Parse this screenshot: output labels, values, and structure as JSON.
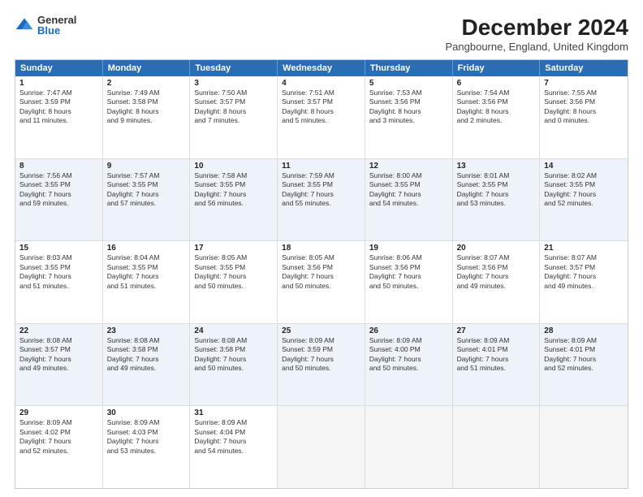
{
  "logo": {
    "general": "General",
    "blue": "Blue"
  },
  "title": "December 2024",
  "location": "Pangbourne, England, United Kingdom",
  "header_days": [
    "Sunday",
    "Monday",
    "Tuesday",
    "Wednesday",
    "Thursday",
    "Friday",
    "Saturday"
  ],
  "rows": [
    [
      {
        "day": "1",
        "lines": [
          "Sunrise: 7:47 AM",
          "Sunset: 3:59 PM",
          "Daylight: 8 hours",
          "and 11 minutes."
        ]
      },
      {
        "day": "2",
        "lines": [
          "Sunrise: 7:49 AM",
          "Sunset: 3:58 PM",
          "Daylight: 8 hours",
          "and 9 minutes."
        ]
      },
      {
        "day": "3",
        "lines": [
          "Sunrise: 7:50 AM",
          "Sunset: 3:57 PM",
          "Daylight: 8 hours",
          "and 7 minutes."
        ]
      },
      {
        "day": "4",
        "lines": [
          "Sunrise: 7:51 AM",
          "Sunset: 3:57 PM",
          "Daylight: 8 hours",
          "and 5 minutes."
        ]
      },
      {
        "day": "5",
        "lines": [
          "Sunrise: 7:53 AM",
          "Sunset: 3:56 PM",
          "Daylight: 8 hours",
          "and 3 minutes."
        ]
      },
      {
        "day": "6",
        "lines": [
          "Sunrise: 7:54 AM",
          "Sunset: 3:56 PM",
          "Daylight: 8 hours",
          "and 2 minutes."
        ]
      },
      {
        "day": "7",
        "lines": [
          "Sunrise: 7:55 AM",
          "Sunset: 3:56 PM",
          "Daylight: 8 hours",
          "and 0 minutes."
        ]
      }
    ],
    [
      {
        "day": "8",
        "lines": [
          "Sunrise: 7:56 AM",
          "Sunset: 3:55 PM",
          "Daylight: 7 hours",
          "and 59 minutes."
        ]
      },
      {
        "day": "9",
        "lines": [
          "Sunrise: 7:57 AM",
          "Sunset: 3:55 PM",
          "Daylight: 7 hours",
          "and 57 minutes."
        ]
      },
      {
        "day": "10",
        "lines": [
          "Sunrise: 7:58 AM",
          "Sunset: 3:55 PM",
          "Daylight: 7 hours",
          "and 56 minutes."
        ]
      },
      {
        "day": "11",
        "lines": [
          "Sunrise: 7:59 AM",
          "Sunset: 3:55 PM",
          "Daylight: 7 hours",
          "and 55 minutes."
        ]
      },
      {
        "day": "12",
        "lines": [
          "Sunrise: 8:00 AM",
          "Sunset: 3:55 PM",
          "Daylight: 7 hours",
          "and 54 minutes."
        ]
      },
      {
        "day": "13",
        "lines": [
          "Sunrise: 8:01 AM",
          "Sunset: 3:55 PM",
          "Daylight: 7 hours",
          "and 53 minutes."
        ]
      },
      {
        "day": "14",
        "lines": [
          "Sunrise: 8:02 AM",
          "Sunset: 3:55 PM",
          "Daylight: 7 hours",
          "and 52 minutes."
        ]
      }
    ],
    [
      {
        "day": "15",
        "lines": [
          "Sunrise: 8:03 AM",
          "Sunset: 3:55 PM",
          "Daylight: 7 hours",
          "and 51 minutes."
        ]
      },
      {
        "day": "16",
        "lines": [
          "Sunrise: 8:04 AM",
          "Sunset: 3:55 PM",
          "Daylight: 7 hours",
          "and 51 minutes."
        ]
      },
      {
        "day": "17",
        "lines": [
          "Sunrise: 8:05 AM",
          "Sunset: 3:55 PM",
          "Daylight: 7 hours",
          "and 50 minutes."
        ]
      },
      {
        "day": "18",
        "lines": [
          "Sunrise: 8:05 AM",
          "Sunset: 3:56 PM",
          "Daylight: 7 hours",
          "and 50 minutes."
        ]
      },
      {
        "day": "19",
        "lines": [
          "Sunrise: 8:06 AM",
          "Sunset: 3:56 PM",
          "Daylight: 7 hours",
          "and 50 minutes."
        ]
      },
      {
        "day": "20",
        "lines": [
          "Sunrise: 8:07 AM",
          "Sunset: 3:56 PM",
          "Daylight: 7 hours",
          "and 49 minutes."
        ]
      },
      {
        "day": "21",
        "lines": [
          "Sunrise: 8:07 AM",
          "Sunset: 3:57 PM",
          "Daylight: 7 hours",
          "and 49 minutes."
        ]
      }
    ],
    [
      {
        "day": "22",
        "lines": [
          "Sunrise: 8:08 AM",
          "Sunset: 3:57 PM",
          "Daylight: 7 hours",
          "and 49 minutes."
        ]
      },
      {
        "day": "23",
        "lines": [
          "Sunrise: 8:08 AM",
          "Sunset: 3:58 PM",
          "Daylight: 7 hours",
          "and 49 minutes."
        ]
      },
      {
        "day": "24",
        "lines": [
          "Sunrise: 8:08 AM",
          "Sunset: 3:58 PM",
          "Daylight: 7 hours",
          "and 50 minutes."
        ]
      },
      {
        "day": "25",
        "lines": [
          "Sunrise: 8:09 AM",
          "Sunset: 3:59 PM",
          "Daylight: 7 hours",
          "and 50 minutes."
        ]
      },
      {
        "day": "26",
        "lines": [
          "Sunrise: 8:09 AM",
          "Sunset: 4:00 PM",
          "Daylight: 7 hours",
          "and 50 minutes."
        ]
      },
      {
        "day": "27",
        "lines": [
          "Sunrise: 8:09 AM",
          "Sunset: 4:01 PM",
          "Daylight: 7 hours",
          "and 51 minutes."
        ]
      },
      {
        "day": "28",
        "lines": [
          "Sunrise: 8:09 AM",
          "Sunset: 4:01 PM",
          "Daylight: 7 hours",
          "and 52 minutes."
        ]
      }
    ],
    [
      {
        "day": "29",
        "lines": [
          "Sunrise: 8:09 AM",
          "Sunset: 4:02 PM",
          "Daylight: 7 hours",
          "and 52 minutes."
        ]
      },
      {
        "day": "30",
        "lines": [
          "Sunrise: 8:09 AM",
          "Sunset: 4:03 PM",
          "Daylight: 7 hours",
          "and 53 minutes."
        ]
      },
      {
        "day": "31",
        "lines": [
          "Sunrise: 8:09 AM",
          "Sunset: 4:04 PM",
          "Daylight: 7 hours",
          "and 54 minutes."
        ]
      },
      {
        "day": "",
        "lines": []
      },
      {
        "day": "",
        "lines": []
      },
      {
        "day": "",
        "lines": []
      },
      {
        "day": "",
        "lines": []
      }
    ]
  ],
  "alt_rows": [
    1,
    3
  ],
  "colors": {
    "header_bg": "#2a6db5",
    "alt_row_bg": "#eef2f9",
    "empty_bg": "#f5f5f5"
  }
}
